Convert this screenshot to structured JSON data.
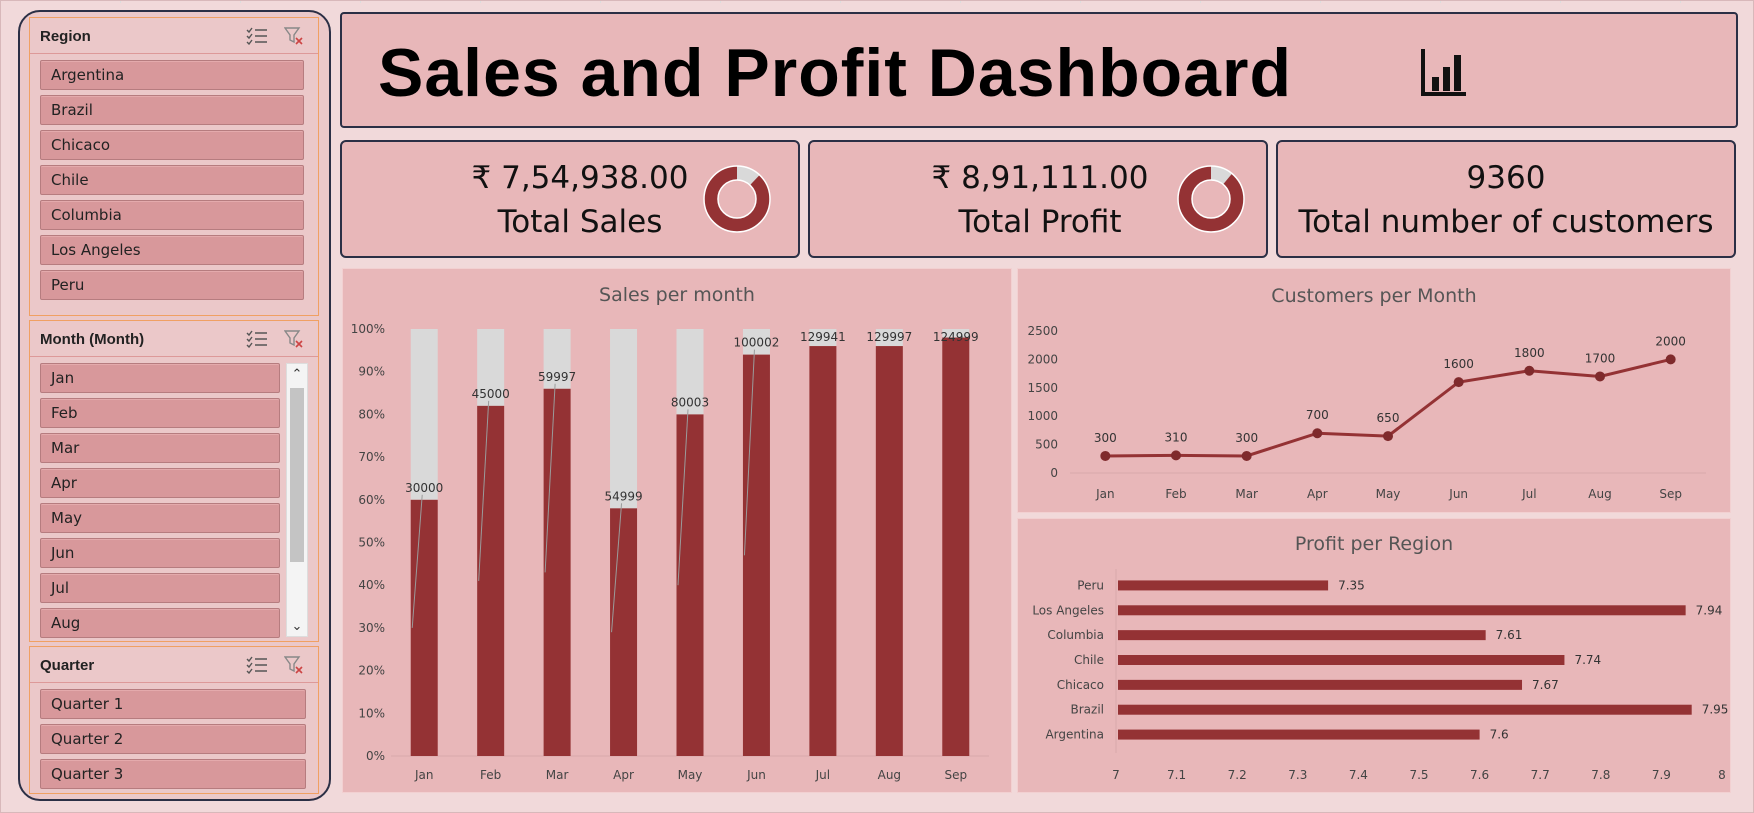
{
  "slicers": {
    "region": {
      "title": "Region",
      "items": [
        "Argentina",
        "Brazil",
        "Chicaco",
        "Chile",
        "Columbia",
        "Los Angeles",
        "Peru"
      ]
    },
    "month": {
      "title": "Month (Month)",
      "items": [
        "Jan",
        "Feb",
        "Mar",
        "Apr",
        "May",
        "Jun",
        "Jul",
        "Aug"
      ]
    },
    "quarter": {
      "title": "Quarter",
      "items": [
        "Quarter 1",
        "Quarter 2",
        "Quarter 3"
      ]
    }
  },
  "header": {
    "title": "Sales and Profit Dashboard",
    "icon": "bar-chart-icon"
  },
  "kpis": {
    "sales": {
      "value": "₹ 7,54,938.00",
      "label": "Total Sales",
      "donut_fill": 0.88
    },
    "profit": {
      "value": "₹ 8,91,111.00",
      "label": "Total Profit",
      "donut_fill": 0.89
    },
    "customers": {
      "value": "9360",
      "label": "Total number of customers"
    }
  },
  "colors": {
    "accent": "#943234",
    "background": "#e8b7b9",
    "remainder": "#d9d9d9"
  },
  "chart_data": [
    {
      "type": "bar",
      "title": "Sales per month",
      "categories": [
        "Jan",
        "Feb",
        "Mar",
        "Apr",
        "May",
        "Jun",
        "Jul",
        "Aug",
        "Sep"
      ],
      "values": [
        30000,
        45000,
        59997,
        54999,
        80003,
        100002,
        129941,
        129997,
        124999
      ],
      "percent": [
        60,
        82,
        86,
        58,
        80,
        94,
        96,
        96,
        98
      ],
      "yticks": [
        "0%",
        "10%",
        "20%",
        "30%",
        "40%",
        "50%",
        "60%",
        "70%",
        "80%",
        "90%",
        "100%"
      ],
      "ylim": [
        0,
        100
      ]
    },
    {
      "type": "line",
      "title": "Customers per Month",
      "categories": [
        "Jan",
        "Feb",
        "Mar",
        "Apr",
        "May",
        "Jun",
        "Jul",
        "Aug",
        "Sep"
      ],
      "values": [
        300,
        310,
        300,
        700,
        650,
        1600,
        1800,
        1700,
        2000
      ],
      "yticks": [
        "0",
        "500",
        "1000",
        "1500",
        "2000",
        "2500"
      ],
      "ylim": [
        0,
        2500
      ]
    },
    {
      "type": "bar",
      "title": "Profit per Region",
      "categories": [
        "Peru",
        "Los Angeles",
        "Columbia",
        "Chile",
        "Chicaco",
        "Brazil",
        "Argentina"
      ],
      "values": [
        7.35,
        7.94,
        7.61,
        7.74,
        7.67,
        7.95,
        7.6
      ],
      "xticks": [
        "7",
        "7.1",
        "7.2",
        "7.3",
        "7.4",
        "7.5",
        "7.6",
        "7.7",
        "7.8",
        "7.9",
        "8"
      ],
      "xlim": [
        7,
        8
      ]
    }
  ]
}
